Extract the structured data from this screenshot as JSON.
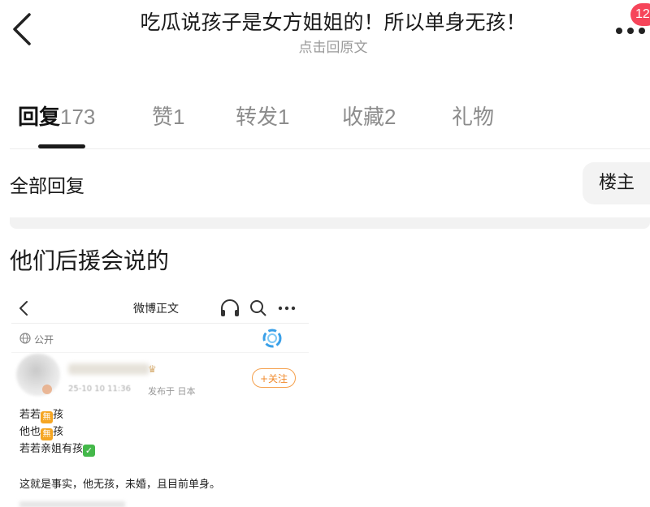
{
  "header": {
    "title": "吃瓜说孩子是女方姐姐的！所以单身无孩！",
    "subtitle": "点击回原文",
    "badge": "12",
    "icons": [
      "back-chevron-icon",
      "more-dots-icon"
    ]
  },
  "tabs": [
    {
      "label": "回复",
      "count": "173",
      "active": true
    },
    {
      "label": "赞",
      "count": "1"
    },
    {
      "label": "转发",
      "count": "1"
    },
    {
      "label": "收藏",
      "count": "2"
    },
    {
      "label": "礼物",
      "count": ""
    }
  ],
  "section": {
    "all_replies": "全部回复",
    "author_filter": "楼主"
  },
  "comment": {
    "text": "他们后援会说的"
  },
  "embedded": {
    "nav_title": "微博正文",
    "public_label": "公开",
    "follow_label": "+关注",
    "meta_blur": "25-10 10 11:36",
    "meta_location": "发布于 日本",
    "line1_a": "若若",
    "line1_b": "孩",
    "line2_a": "他也",
    "line2_b": "孩",
    "emoji_label": "無",
    "line3": "若若亲姐有孩",
    "check_mark": "✓",
    "body": "这就是事实，他无孩，未婚，且目前单身。",
    "colors": {
      "follow": "#f08a2c",
      "emoji": "#f5a623",
      "check": "#44b84a"
    }
  }
}
